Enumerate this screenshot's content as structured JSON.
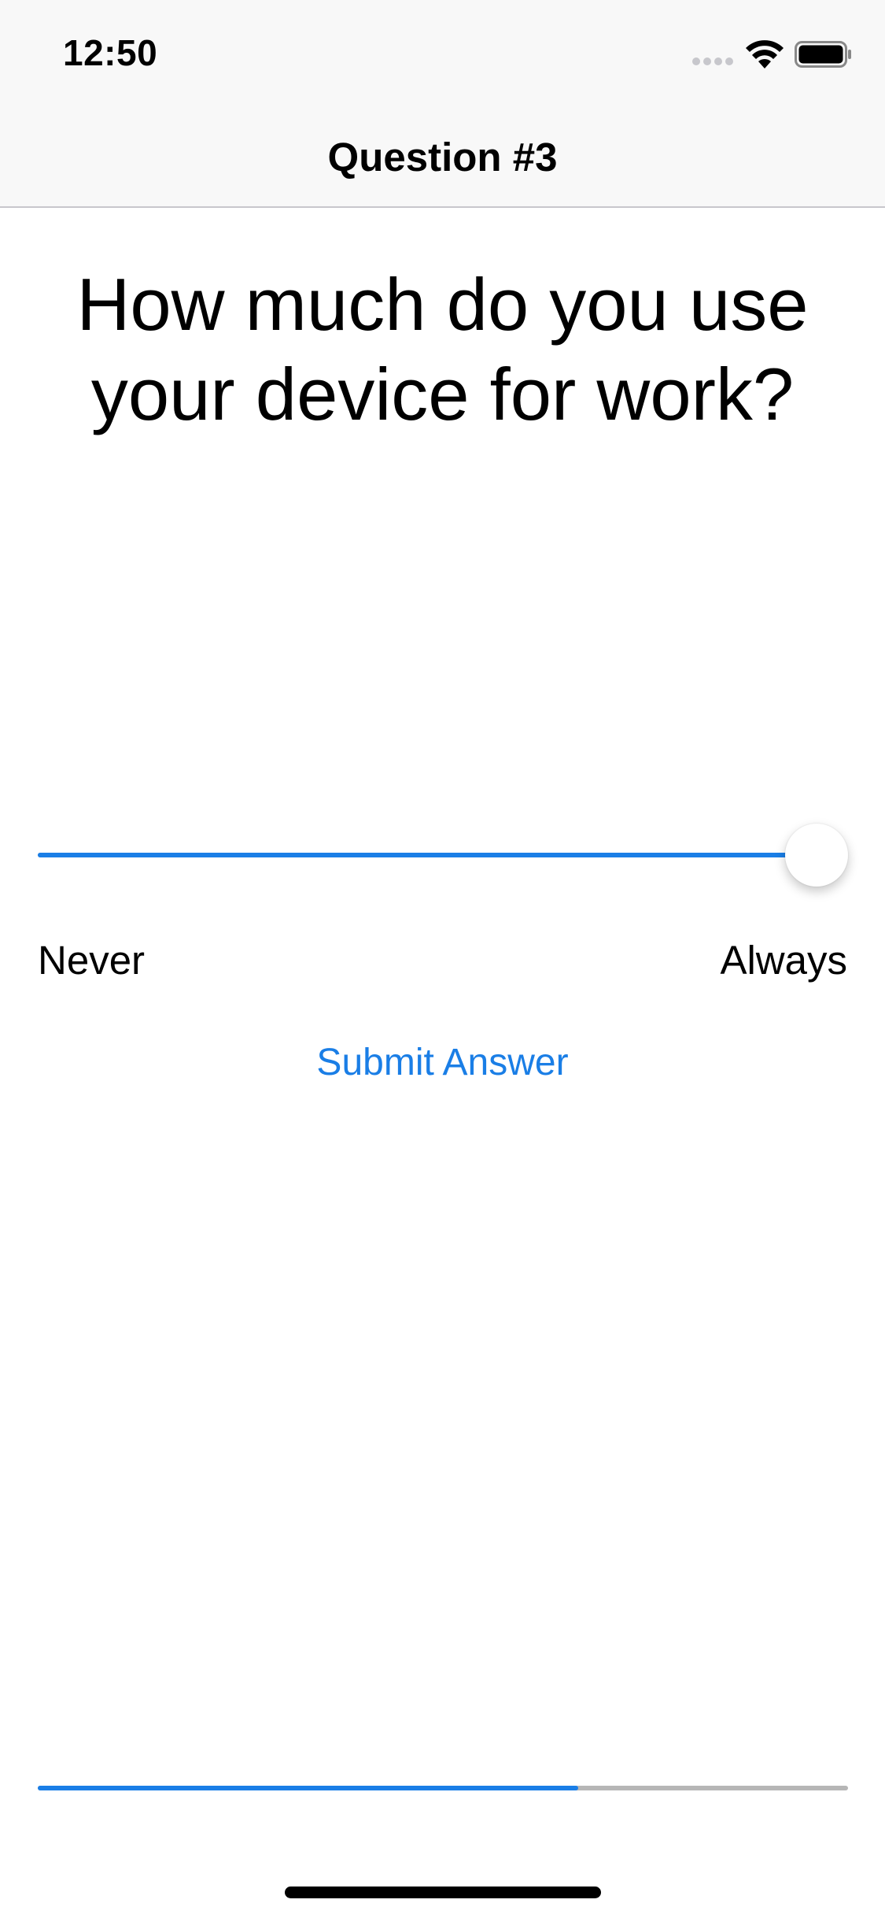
{
  "status_bar": {
    "time": "12:50",
    "signal_icon": "cellular-signal-icon",
    "wifi_icon": "wifi-icon",
    "battery_icon": "battery-icon"
  },
  "nav": {
    "title": "Question #3"
  },
  "question": {
    "text": "How much do you use your device for work?"
  },
  "slider": {
    "value_fraction": 1.0,
    "min_label": "Never",
    "max_label": "Always"
  },
  "submit": {
    "label": "Submit Answer"
  },
  "progress": {
    "fraction": 0.667
  },
  "colors": {
    "accent": "#1a7ee6",
    "track": "#b6b6b6",
    "bar_background": "#f8f8f8"
  }
}
